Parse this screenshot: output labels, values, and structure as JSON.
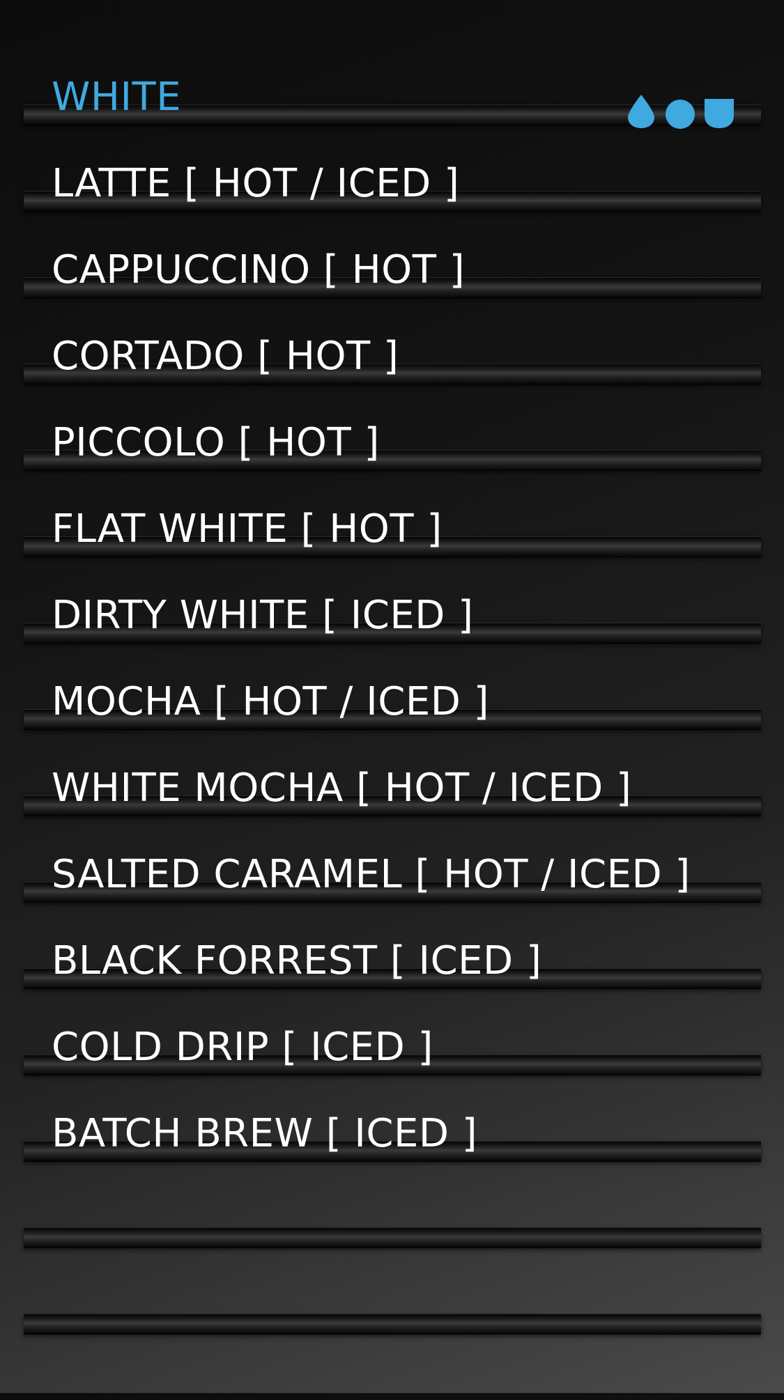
{
  "header": {
    "title": "WHITE",
    "accent_color": "#3fa9e0",
    "icons": [
      "drop-icon",
      "circle-icon",
      "cup-icon"
    ]
  },
  "menu": {
    "items": [
      "LATTE [ HOT / ICED ]",
      "CAPPUCCINO [ HOT ]",
      "CORTADO [ HOT ]",
      "PICCOLO [ HOT ]",
      "FLAT WHITE [ HOT ]",
      "DIRTY WHITE [ ICED ]",
      "MOCHA [ HOT / ICED ]",
      "WHITE MOCHA [ HOT / ICED ]",
      "SALTED CARAMEL [ HOT / ICED ]",
      "BLACK FORREST [ ICED ]",
      "COLD DRIP [ ICED ]",
      "BATCH BREW [ ICED ]"
    ]
  }
}
